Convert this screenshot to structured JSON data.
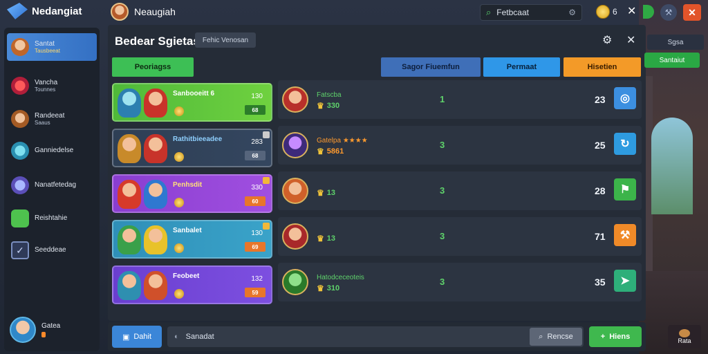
{
  "app": {
    "title": "Nedangiat",
    "subtitle": ""
  },
  "header": {
    "player_name": "Neaugiah",
    "search_value": "Fetbcaat",
    "coins": "6"
  },
  "sidebar": {
    "items": [
      {
        "label": "Santat",
        "sub": "Tausbeeat",
        "active": true
      },
      {
        "label": "Vancha",
        "sub": "Tounnes"
      },
      {
        "label": "Randeeat",
        "sub": "Saaus"
      },
      {
        "label": "Ganniedelse",
        "sub": ""
      },
      {
        "label": "Nanatfetedag",
        "sub": ""
      },
      {
        "label": "Reishtahie",
        "sub": ""
      },
      {
        "label": "Seeddeae",
        "sub": ""
      }
    ],
    "user": {
      "name": "Gatea"
    }
  },
  "panel": {
    "title": "Bedear Sgietas",
    "chip": "Fehic Venosan",
    "tabs": [
      "Peoriagss",
      "Sagor Fiuemfun",
      "Permaat",
      "Hisetien"
    ]
  },
  "teams": [
    {
      "name": "Sanbooeitt 6",
      "num": "130",
      "btn": "68",
      "color": "green"
    },
    {
      "name": "Rathitbieeadee",
      "num": "283",
      "btn": "68",
      "color": "navy"
    },
    {
      "name": "Penhsdit",
      "num": "330",
      "btn": "60",
      "color": "purple"
    },
    {
      "name": "Sanbalet",
      "num": "130",
      "btn": "69",
      "color": "teal"
    },
    {
      "name": "Feobeet",
      "num": "132",
      "btn": "59",
      "color": "violet"
    }
  ],
  "results": [
    {
      "name": "Fatscba",
      "stars": "",
      "value": "330",
      "mid": "1",
      "score": "23",
      "action_icon": "target-icon",
      "action_color": "#3c8fe0"
    },
    {
      "name": "Gatelpa",
      "stars": "★★★★",
      "value": "5861",
      "mid": "3",
      "score": "25",
      "action_icon": "refresh-icon",
      "action_color": "#2e9be0"
    },
    {
      "name": "",
      "stars": "",
      "value": "13",
      "mid": "3",
      "score": "28",
      "action_icon": "flag-icon",
      "action_color": "#3cb44a"
    },
    {
      "name": "",
      "stars": "",
      "value": "13",
      "mid": "3",
      "score": "71",
      "action_icon": "wrench-icon",
      "action_color": "#f08a28"
    },
    {
      "name": "Hatodceceoteis",
      "stars": "",
      "value": "310",
      "mid": "3",
      "score": "35",
      "action_icon": "share-icon",
      "action_color": "#2eaf7a"
    }
  ],
  "bottom": {
    "start_label": "Dahit",
    "input_value": "Sanadat",
    "cancel_label": "Rencse",
    "next_label": "Hiens"
  },
  "right": {
    "label1": "Sgsa",
    "label2": "Santaiut",
    "bottom_label": "Rata"
  }
}
